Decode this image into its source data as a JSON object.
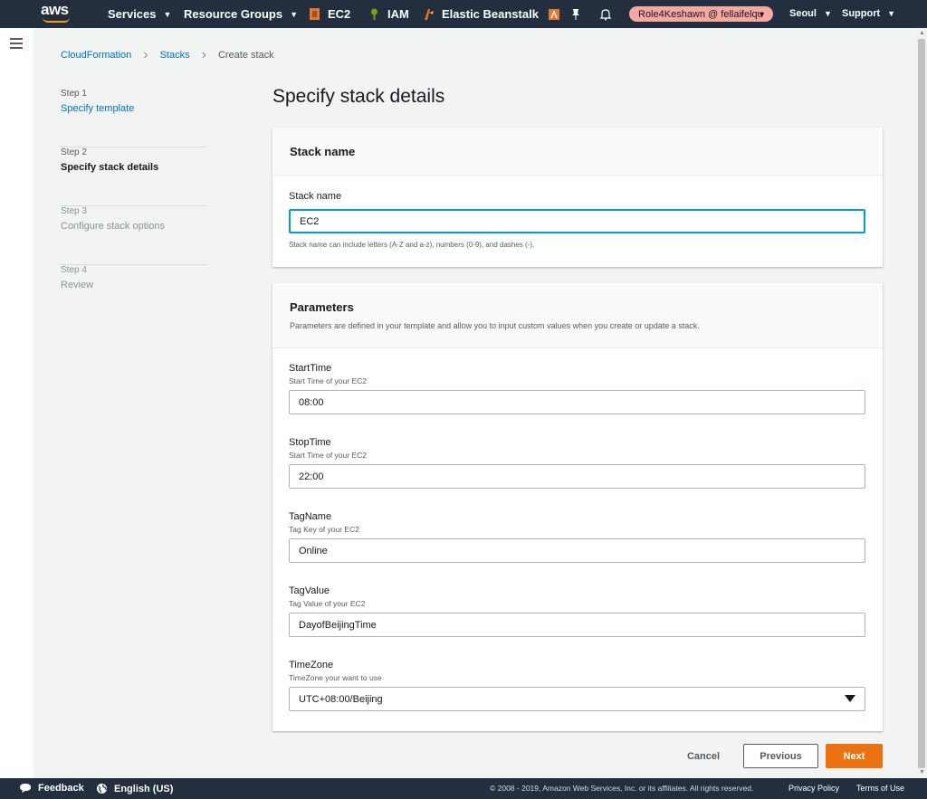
{
  "nav": {
    "logo": "aws",
    "services": "Services",
    "resource_groups": "Resource Groups",
    "ec2": "EC2",
    "iam": "IAM",
    "beanstalk": "Elastic Beanstalk",
    "account": "Role4Keshawn @ fellaifelqu",
    "region": "Seoul",
    "support": "Support",
    "icons": [
      "ec2-icon",
      "iam-icon",
      "beanstalk-icon",
      "lambda-icon",
      "pin-icon",
      "bell-icon"
    ],
    "account_color": "#f7a8a0",
    "accent": "#ff9900"
  },
  "breadcrumb": {
    "items": [
      "CloudFormation",
      "Stacks"
    ],
    "current": "Create stack"
  },
  "steps": [
    {
      "num": "Step 1",
      "label": "Specify template",
      "state": "done"
    },
    {
      "num": "Step 2",
      "label": "Specify stack details",
      "state": "active"
    },
    {
      "num": "Step 3",
      "label": "Configure stack options",
      "state": "future"
    },
    {
      "num": "Step 4",
      "label": "Review",
      "state": "future"
    }
  ],
  "page_title": "Specify stack details",
  "stack_name_panel": {
    "header": "Stack name",
    "label": "Stack name",
    "value": "EC2",
    "constraint": "Stack name can include letters (A-Z and a-z), numbers (0-9), and dashes (-)."
  },
  "parameters_panel": {
    "header": "Parameters",
    "description": "Parameters are defined in your template and allow you to input custom values when you create or update a stack.",
    "fields": [
      {
        "name": "StartTime",
        "desc": "Start Time of your EC2",
        "value": "08:00"
      },
      {
        "name": "StopTime",
        "desc": "Start Time of your EC2",
        "value": "22:00"
      },
      {
        "name": "TagName",
        "desc": "Tag Key of your EC2",
        "value": "Online"
      },
      {
        "name": "TagValue",
        "desc": "Tag Value of your EC2",
        "value": "DayofBeijingTime"
      },
      {
        "name": "TimeZone",
        "desc": "TimeZone your want to use",
        "value": "UTC+08:00/Beijing"
      }
    ]
  },
  "buttons": {
    "cancel": "Cancel",
    "previous": "Previous",
    "next": "Next",
    "next_color": "#ec7211"
  },
  "footer": {
    "feedback": "Feedback",
    "language": "English (US)",
    "copyright": "© 2008 - 2019, Amazon Web Services, Inc. or its affiliates. All rights reserved.",
    "privacy": "Privacy Policy",
    "terms": "Terms of Use"
  }
}
